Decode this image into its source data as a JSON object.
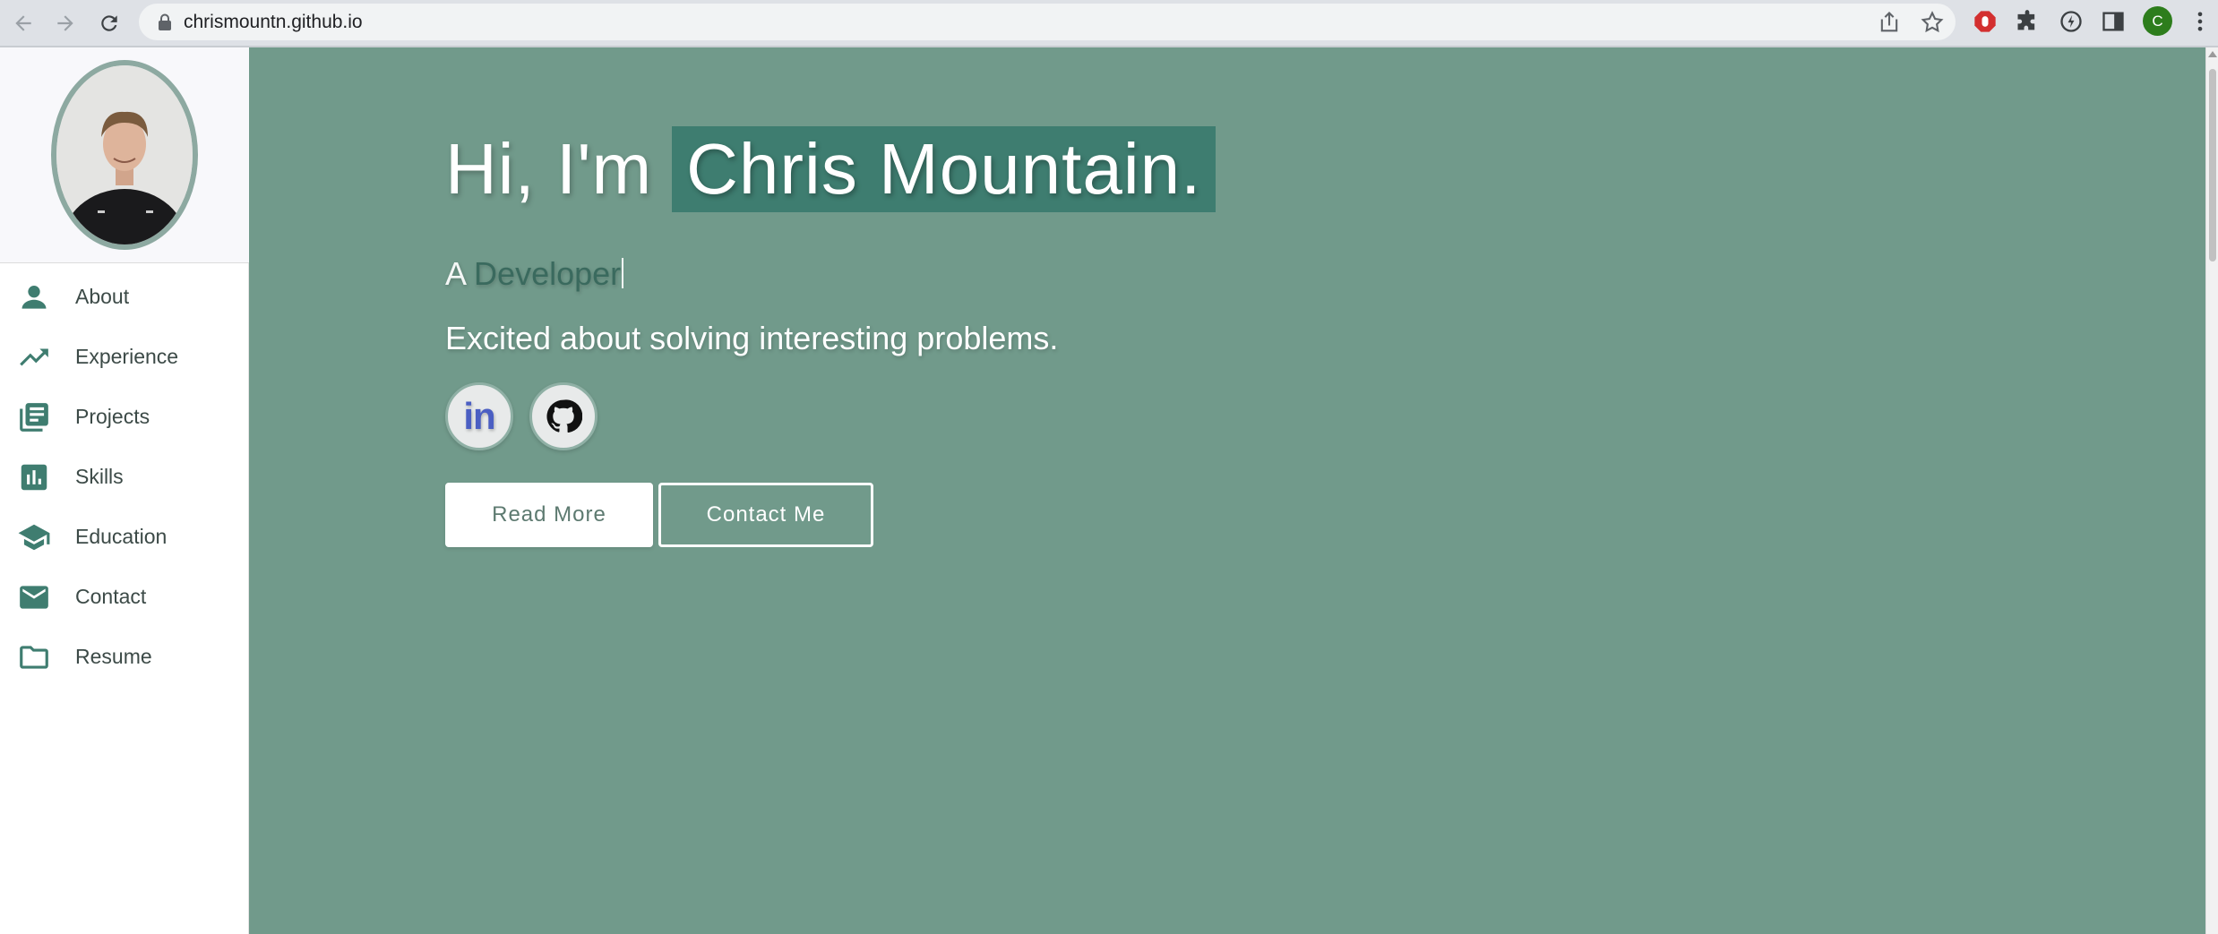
{
  "browser": {
    "url": "chrismountn.github.io",
    "profile_initial": "C"
  },
  "sidebar": {
    "items": [
      {
        "label": "About",
        "icon": "person-icon"
      },
      {
        "label": "Experience",
        "icon": "trending-up-icon"
      },
      {
        "label": "Projects",
        "icon": "library-books-icon"
      },
      {
        "label": "Skills",
        "icon": "bar-chart-icon"
      },
      {
        "label": "Education",
        "icon": "school-icon"
      },
      {
        "label": "Contact",
        "icon": "mail-icon"
      },
      {
        "label": "Resume",
        "icon": "folder-icon"
      }
    ]
  },
  "hero": {
    "greeting": "Hi, I'm",
    "name": "Chris Mountain.",
    "role_prefix": "A",
    "role_word": "Developer",
    "tagline": "Excited about solving interesting problems.",
    "linkedin_text": "in",
    "read_more": "Read More",
    "contact_me": "Contact Me"
  },
  "colors": {
    "hero_bg": "#719a8b",
    "accent": "#3e7d70",
    "sidebar_icon": "#3f7d70"
  }
}
